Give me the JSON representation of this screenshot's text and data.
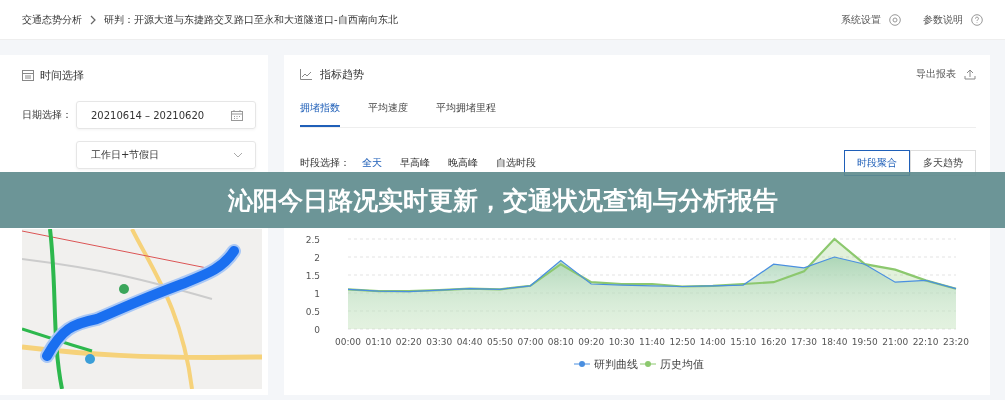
{
  "breadcrumb": {
    "root": "交通态势分析",
    "current": "研判：开源大道与东捷路交叉路口至永和大道隧道口-自西南向东北"
  },
  "header_links": [
    {
      "label": "系统设置",
      "kind": "settings"
    },
    {
      "label": "参数说明",
      "kind": "help"
    }
  ],
  "time_panel": {
    "title": "时间选择",
    "date_label": "日期选择：",
    "date_range": "20210614  –  20210620",
    "day_type": "工作日+节假日"
  },
  "trend_panel": {
    "title": "指标趋势",
    "export": "导出报表",
    "tabs": [
      {
        "label": "拥堵指数",
        "selected": true
      },
      {
        "label": "平均速度",
        "selected": false
      },
      {
        "label": "平均拥堵里程",
        "selected": false
      }
    ],
    "period_label": "时段选择：",
    "periods": [
      {
        "label": "全天",
        "selected": true
      },
      {
        "label": "早高峰",
        "selected": false
      },
      {
        "label": "晚高峰",
        "selected": false
      },
      {
        "label": "自选时段",
        "selected": false
      }
    ],
    "modes": [
      {
        "label": "时段聚合",
        "selected": true
      },
      {
        "label": "多天趋势",
        "selected": false
      }
    ],
    "chart_data": {
      "type": "area",
      "categories": [
        "00:00",
        "01:10",
        "02:20",
        "03:30",
        "04:40",
        "05:50",
        "07:00",
        "08:10",
        "09:20",
        "10:30",
        "11:40",
        "12:50",
        "14:00",
        "15:10",
        "16:20",
        "17:30",
        "18:40",
        "19:50",
        "21:00",
        "22:10",
        "23:20"
      ],
      "series": [
        {
          "name": "研判曲线",
          "color": "#4a8fe0",
          "values": [
            1.1,
            1.05,
            1.04,
            1.08,
            1.12,
            1.1,
            1.2,
            1.9,
            1.25,
            1.22,
            1.2,
            1.18,
            1.2,
            1.22,
            1.8,
            1.7,
            2.0,
            1.8,
            1.3,
            1.35,
            1.12
          ]
        },
        {
          "name": "历史均值",
          "color": "#8cc86e",
          "values": [
            1.1,
            1.05,
            1.05,
            1.08,
            1.12,
            1.1,
            1.2,
            1.8,
            1.3,
            1.25,
            1.25,
            1.18,
            1.2,
            1.25,
            1.3,
            1.6,
            2.5,
            1.8,
            1.65,
            1.35,
            1.12
          ]
        }
      ],
      "ylim": [
        0,
        2.5
      ],
      "yticks": [
        0,
        0.5,
        1,
        1.5,
        2,
        2.5
      ],
      "grid": true,
      "legend": true
    }
  },
  "banner": {
    "title": "沁阳今日路况实时更新，交通状况查询与分析报告"
  }
}
